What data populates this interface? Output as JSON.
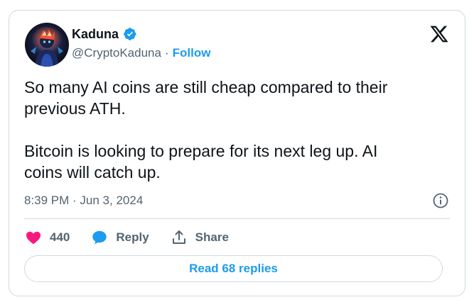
{
  "author": {
    "display_name": "Kaduna",
    "handle": "@CryptoKaduna",
    "separator": "·",
    "follow_label": "Follow",
    "verified": true
  },
  "tweet": {
    "text": "So many AI coins are still cheap compared to their\nprevious ATH.\n\nBitcoin is looking to prepare for its next leg up. AI\ncoins will catch up.",
    "timestamp": "8:39 PM · Jun 3, 2024"
  },
  "actions": {
    "like_count": "440",
    "reply_label": "Reply",
    "share_label": "Share"
  },
  "read_replies_label": "Read 68 replies",
  "icons": {
    "brand": "x-logo-icon",
    "verified": "verified-badge-icon",
    "like": "heart-icon",
    "reply": "speech-bubble-icon",
    "share": "share-upload-icon",
    "info": "info-icon"
  },
  "colors": {
    "accent": "#1d9bf0",
    "like": "#f91880",
    "text": "#0f1419",
    "secondary": "#536471",
    "border": "#cfd9de"
  }
}
